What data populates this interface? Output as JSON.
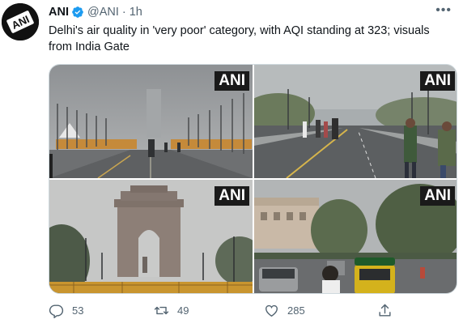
{
  "tweet": {
    "author_name": "ANI",
    "handle": "@ANI",
    "separator": "·",
    "time": "1h",
    "text": "Delhi's air quality in 'very poor' category, with AQI standing at 323; visuals from India Gate",
    "avatar_text": "ANI"
  },
  "media": {
    "watermark": "ANI",
    "images": [
      {
        "icon": "rajpath-smog-photo"
      },
      {
        "icon": "walkers-road-photo"
      },
      {
        "icon": "india-gate-photo"
      },
      {
        "icon": "traffic-autorickshaw-photo"
      }
    ]
  },
  "actions": {
    "replies": "53",
    "retweets": "49",
    "likes": "285"
  },
  "colors": {
    "text": "#0f1419",
    "muted": "#536471",
    "verified": "#1d9bf0",
    "border": "#cfd9de"
  }
}
